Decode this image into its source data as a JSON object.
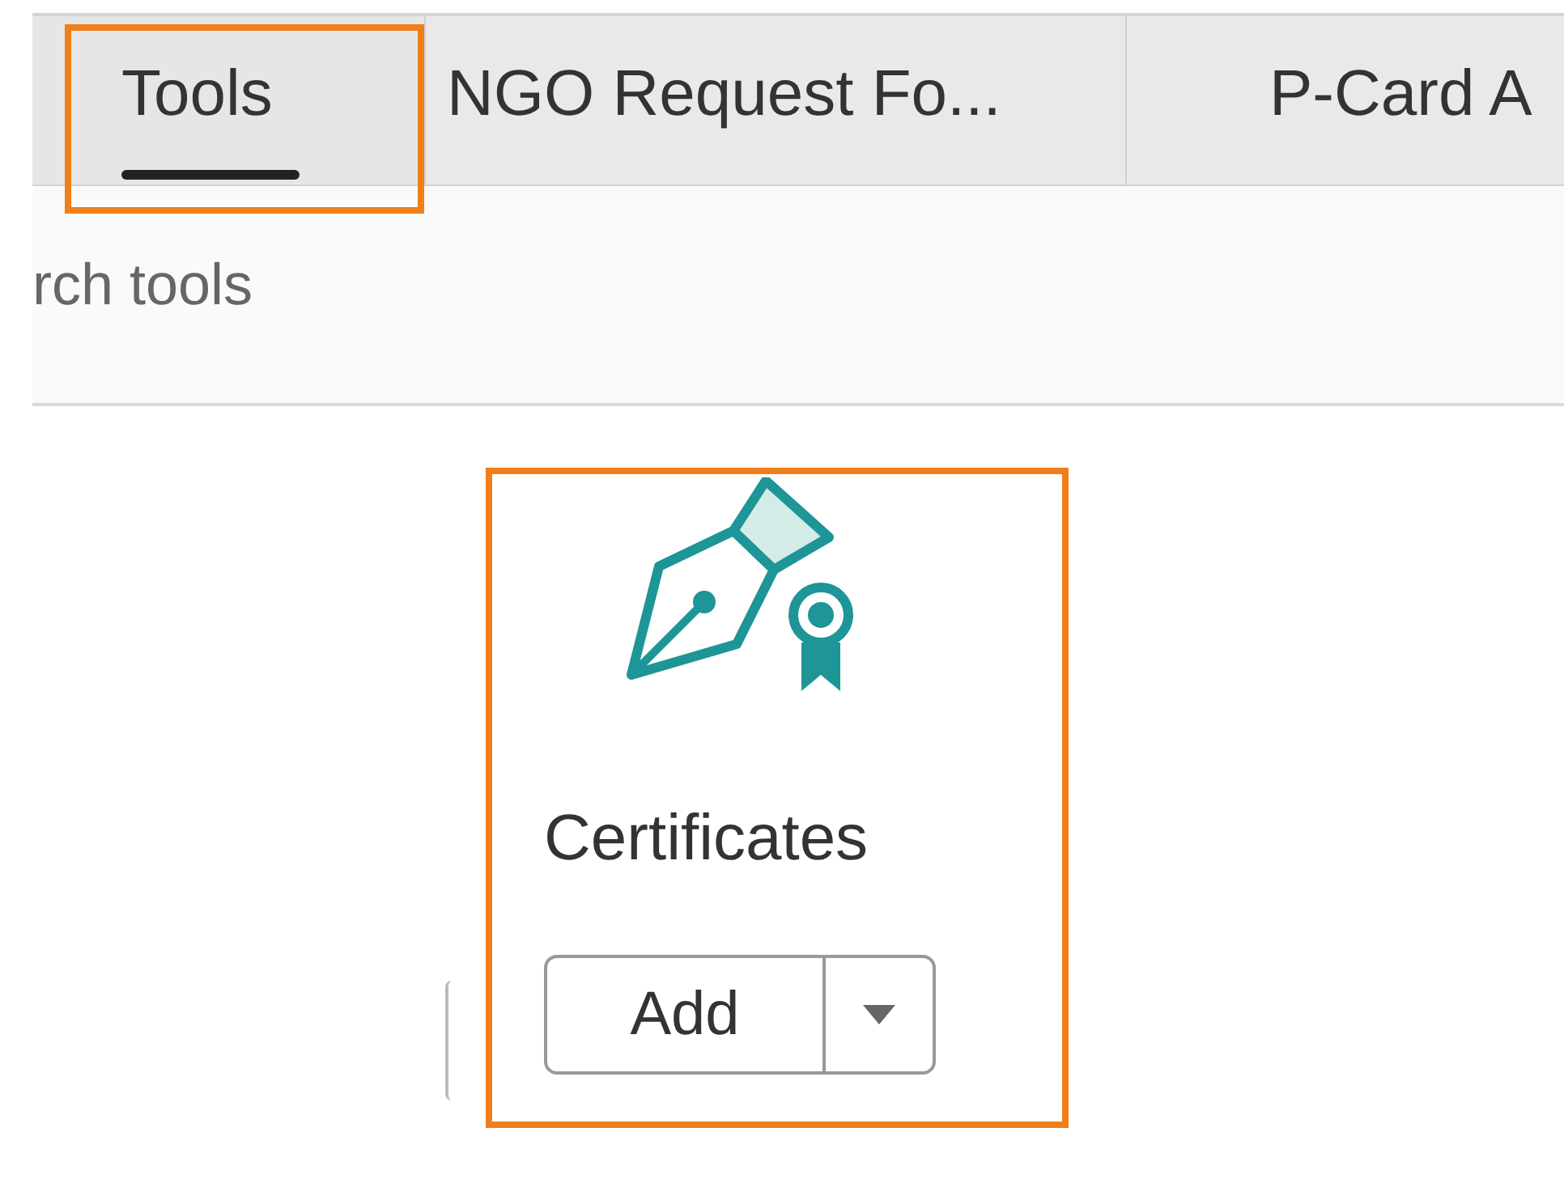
{
  "tabs": [
    {
      "label": "Tools",
      "selected": true,
      "highlighted": true
    },
    {
      "label": "NGO Request Fo...",
      "selected": false,
      "highlighted": false
    },
    {
      "label": "P-Card A",
      "selected": false,
      "highlighted": false
    }
  ],
  "search": {
    "placeholder": "rch tools"
  },
  "tools": [
    {
      "title": "Certificates",
      "button": "Add",
      "highlighted": true
    }
  ]
}
